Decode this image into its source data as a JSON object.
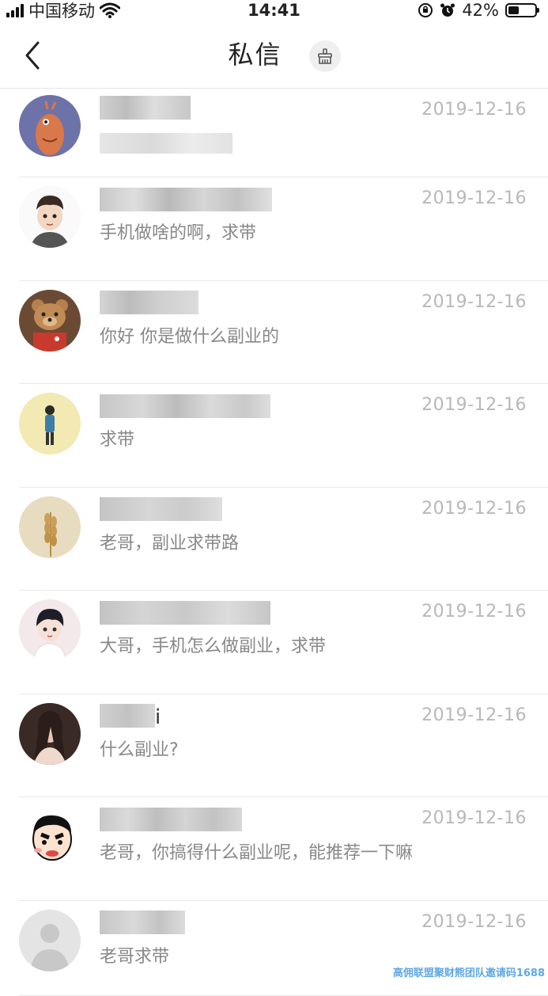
{
  "status_bar": {
    "carrier": "中国移动",
    "time": "14:41",
    "battery": "42%",
    "battery_level": 0.42
  },
  "header": {
    "title": "私信"
  },
  "conversations": [
    {
      "name_visible": "",
      "message": "",
      "date": "2019-12-16",
      "avatar": "cartoon-creature-avatar"
    },
    {
      "name_visible": "",
      "message": "手机做啥的啊，求带",
      "date": "2019-12-16",
      "avatar": "cartoon-boy-avatar"
    },
    {
      "name_visible": "",
      "message": "你好 你是做什么副业的",
      "date": "2019-12-16",
      "avatar": "teddy-bear-avatar"
    },
    {
      "name_visible": "",
      "message": "求带",
      "date": "2019-12-16",
      "avatar": "standing-figure-avatar"
    },
    {
      "name_visible": "",
      "message": "老哥，副业求带路",
      "date": "2019-12-16",
      "avatar": "wheat-avatar"
    },
    {
      "name_visible": "",
      "message": "大哥，手机怎么做副业，求带",
      "date": "2019-12-16",
      "avatar": "anime-boy-avatar"
    },
    {
      "name_visible": "i",
      "message": "什么副业?",
      "date": "2019-12-16",
      "avatar": "photo-girl-avatar"
    },
    {
      "name_visible": "",
      "message": "老哥，你搞得什么副业呢，能推荐一下嘛",
      "date": "2019-12-16",
      "avatar": "crayon-cartoon-avatar"
    },
    {
      "name_visible": "",
      "message": "老哥求带",
      "date": "2019-12-16",
      "avatar": "default-avatar"
    }
  ],
  "watermark": "高佣联盟聚财熊团队邀请码1688",
  "colors": {
    "date": "#b8b8b8",
    "message": "#888888",
    "divider": "#e8e8e8",
    "watermark": "#5fa8e6"
  }
}
